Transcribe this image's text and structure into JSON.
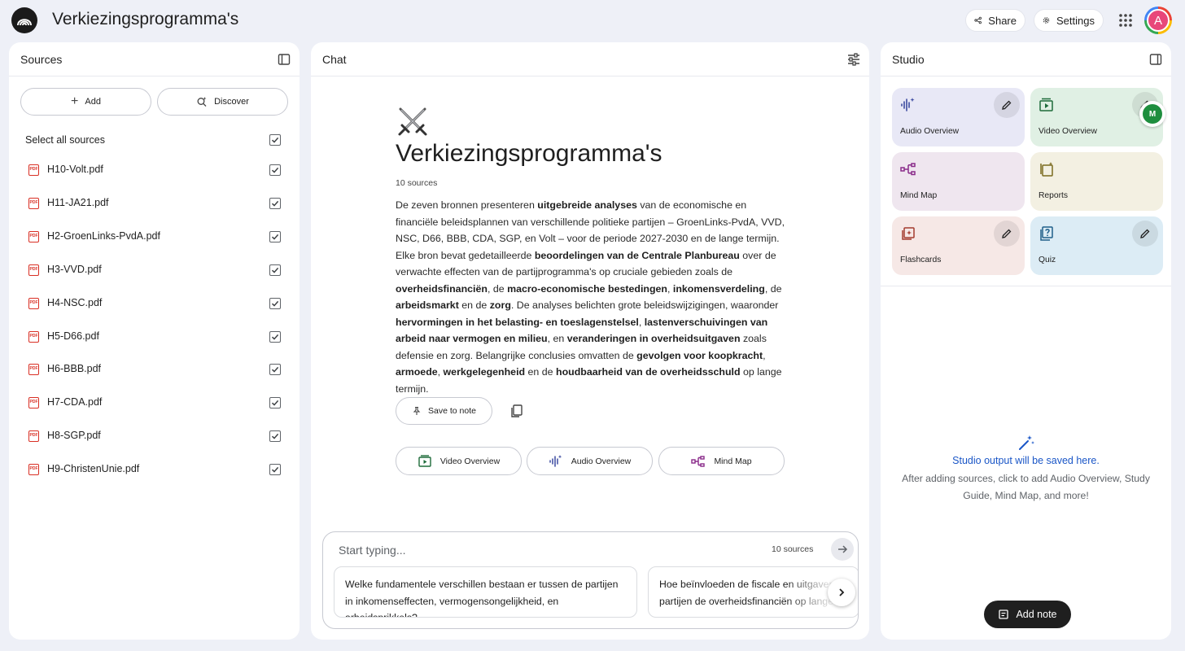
{
  "header": {
    "title": "Verkiezingsprogramma's",
    "share_label": "Share",
    "settings_label": "Settings",
    "avatar_initial": "A"
  },
  "sources": {
    "title": "Sources",
    "add_label": "Add",
    "discover_label": "Discover",
    "select_all_label": "Select all sources",
    "items": [
      {
        "name": "H10-Volt.pdf",
        "checked": true
      },
      {
        "name": "H11-JA21.pdf",
        "checked": true
      },
      {
        "name": "H2-GroenLinks-PvdA.pdf",
        "checked": true
      },
      {
        "name": "H3-VVD.pdf",
        "checked": true
      },
      {
        "name": "H4-NSC.pdf",
        "checked": true
      },
      {
        "name": "H5-D66.pdf",
        "checked": true
      },
      {
        "name": "H6-BBB.pdf",
        "checked": true
      },
      {
        "name": "H7-CDA.pdf",
        "checked": true
      },
      {
        "name": "H8-SGP.pdf",
        "checked": true
      },
      {
        "name": "H9-ChristenUnie.pdf",
        "checked": true
      }
    ]
  },
  "chat": {
    "title": "Chat",
    "emoji": "⚔️",
    "notebook_title": "Verkiezingsprogramma's",
    "source_count": "10 sources",
    "summary": [
      {
        "t": "De zeven bronnen presenteren ",
        "b": false
      },
      {
        "t": "uitgebreide analyses",
        "b": true
      },
      {
        "t": " van de economische en financiële beleidsplannen van verschillende politieke partijen – GroenLinks-PvdA, VVD, NSC, D66, BBB, CDA, SGP, en Volt – voor de periode 2027-2030 en de lange termijn. Elke bron bevat gedetailleerde ",
        "b": false
      },
      {
        "t": "beoordelingen van de Centrale Planbureau",
        "b": true
      },
      {
        "t": " over de verwachte effecten van de partijprogramma's op cruciale gebieden zoals de ",
        "b": false
      },
      {
        "t": "overheidsfinanciën",
        "b": true
      },
      {
        "t": ", de ",
        "b": false
      },
      {
        "t": "macro-economische bestedingen",
        "b": true
      },
      {
        "t": ", ",
        "b": false
      },
      {
        "t": "inkomensverdeling",
        "b": true
      },
      {
        "t": ", de ",
        "b": false
      },
      {
        "t": "arbeidsmarkt",
        "b": true
      },
      {
        "t": " en de ",
        "b": false
      },
      {
        "t": "zorg",
        "b": true
      },
      {
        "t": ". De analyses belichten grote beleidswijzigingen, waaronder ",
        "b": false
      },
      {
        "t": "hervormingen in het belasting- en toeslagenstelsel",
        "b": true
      },
      {
        "t": ", ",
        "b": false
      },
      {
        "t": "lastenverschuivingen van arbeid naar vermogen en milieu",
        "b": true
      },
      {
        "t": ", en ",
        "b": false
      },
      {
        "t": "veranderingen in overheidsuitgaven",
        "b": true
      },
      {
        "t": " zoals defensie en zorg. Belangrijke conclusies omvatten de ",
        "b": false
      },
      {
        "t": "gevolgen voor koopkracht",
        "b": true
      },
      {
        "t": ", ",
        "b": false
      },
      {
        "t": "armoede",
        "b": true
      },
      {
        "t": ", ",
        "b": false
      },
      {
        "t": "werkgelegenheid",
        "b": true
      },
      {
        "t": " en de ",
        "b": false
      },
      {
        "t": "houdbaarheid van de overheidsschuld",
        "b": true
      },
      {
        "t": " op lange termijn.",
        "b": false
      }
    ],
    "save_to_note_label": "Save to note",
    "quick_actions": {
      "video": "Video Overview",
      "audio": "Audio Overview",
      "mind": "Mind Map"
    },
    "composer": {
      "placeholder": "Start typing...",
      "source_count": "10 sources"
    },
    "suggestions": [
      "Welke fundamentele verschillen bestaan er tussen de partijen in inkomenseffecten, vermogensongelijkheid, en arbeidsprikkels?",
      "Hoe beïnvloeden de fiscale en uitgaven de partijen de overheidsfinanciën op lange"
    ]
  },
  "studio": {
    "title": "Studio",
    "tiles": {
      "audio": "Audio Overview",
      "video": "Video Overview",
      "mind": "Mind Map",
      "reports": "Reports",
      "flash": "Flashcards",
      "quiz": "Quiz"
    },
    "extension_badge": "M",
    "empty_title": "Studio output will be saved here.",
    "empty_text": "After adding sources, click to add Audio Overview, Study Guide, Mind Map, and more!",
    "add_note_label": "Add note"
  },
  "colors": {
    "accent_blue": "#1a56c7",
    "pdf_red": "#d93025",
    "audio_tile": "#e8e8f6",
    "video_tile": "#e0f0e4",
    "mind_tile": "#efe6ef",
    "reports_tile": "#f3f0e2",
    "flash_tile": "#f6e8e6",
    "quiz_tile": "#dcecf5"
  }
}
